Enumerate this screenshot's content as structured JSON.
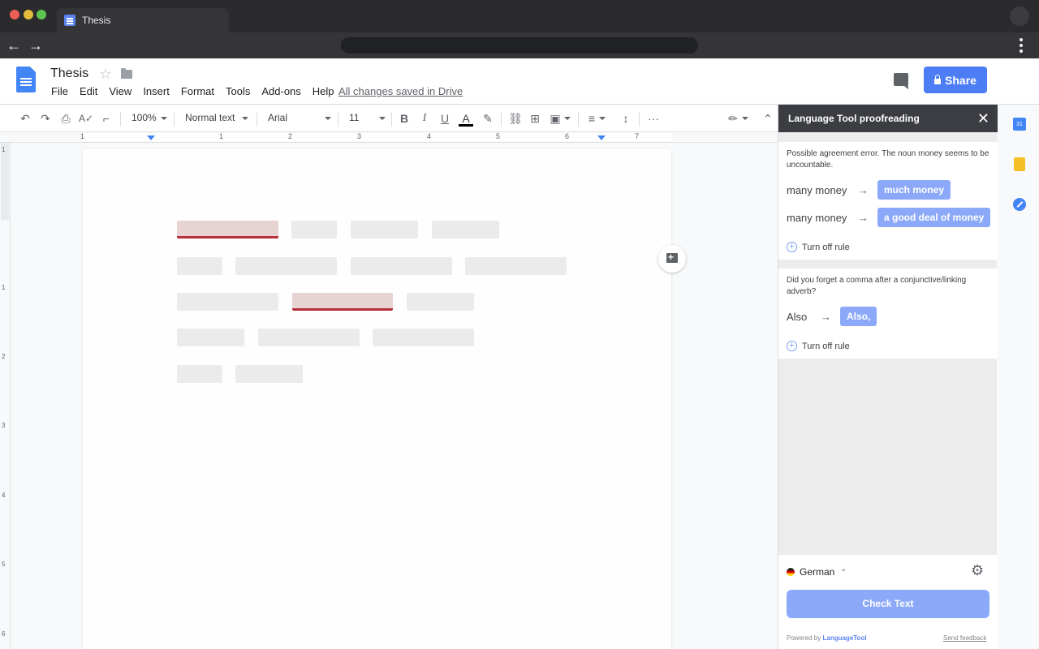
{
  "browser": {
    "tab_title": "Thesis",
    "back_glyph": "←",
    "forward_glyph": "→"
  },
  "docs": {
    "title": "Thesis",
    "menu": [
      "File",
      "Edit",
      "View",
      "Insert",
      "Format",
      "Tools",
      "Add-ons",
      "Help"
    ],
    "saved_status": "All changes saved in Drive",
    "share_label": "Share",
    "icons": [
      "star-icon",
      "folder-icon",
      "comment-icon",
      "lock-icon"
    ]
  },
  "toolbar": {
    "zoom": "100%",
    "style": "Normal text",
    "font": "Arial",
    "font_size": "11",
    "bold_glyph": "B",
    "italic_glyph": "I",
    "underline_glyph": "U",
    "text_color_glyph": "A",
    "more_glyph": "···"
  },
  "ruler": {
    "h_numbers": [
      "1",
      "1",
      "2",
      "3",
      "4",
      "5",
      "6",
      "7"
    ],
    "v_numbers": [
      "1",
      "1",
      "2",
      "3",
      "4",
      "5",
      "6"
    ]
  },
  "languagetool": {
    "header": "Language Tool proofreading",
    "close_glyph": "✕",
    "cards": [
      {
        "description": "Possible agreement error. The noun money seems to be uncountable.",
        "suggestions_rows": [
          {
            "original": "many money",
            "suggestion": "much money"
          },
          {
            "original": "many money",
            "suggestion": "a good deal of money"
          }
        ],
        "turn_off": "Turn off rule"
      },
      {
        "description": "Did you forget a comma after a conjunctive/linking adverb?",
        "suggestions_rows": [
          {
            "original": "Also",
            "suggestion": "Also,"
          }
        ],
        "turn_off": "Turn off rule"
      }
    ],
    "arrow_glyph": "→",
    "language": "German",
    "check_button": "Check Text",
    "powered_prefix": "Powered by",
    "powered_brand": "LanguageTool",
    "feedback": "Send feedback"
  },
  "side_rail": {
    "calendar_label": "31"
  },
  "colors": {
    "accent": "#4c7df5",
    "suggestion": "#8ba9f8",
    "error_underline": "#b5303a"
  }
}
